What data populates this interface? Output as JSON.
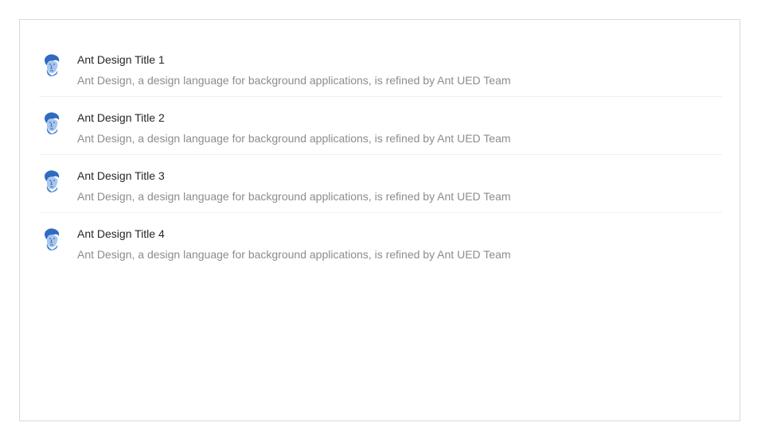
{
  "list": {
    "items": [
      {
        "title": "Ant Design Title 1",
        "description": "Ant Design, a design language for background applications, is refined by Ant UED Team",
        "avatar_icon": "user-portrait-icon"
      },
      {
        "title": "Ant Design Title 2",
        "description": "Ant Design, a design language for background applications, is refined by Ant UED Team",
        "avatar_icon": "user-portrait-icon"
      },
      {
        "title": "Ant Design Title 3",
        "description": "Ant Design, a design language for background applications, is refined by Ant UED Team",
        "avatar_icon": "user-portrait-icon"
      },
      {
        "title": "Ant Design Title 4",
        "description": "Ant Design, a design language for background applications, is refined by Ant UED Team",
        "avatar_icon": "user-portrait-icon"
      }
    ]
  },
  "colors": {
    "avatar_primary": "#2f6bc1",
    "avatar_light": "#a9c6ec",
    "title": "#262626",
    "description": "#8c8c8c",
    "divider": "#f0f0f0",
    "border": "#d9d9d9"
  }
}
